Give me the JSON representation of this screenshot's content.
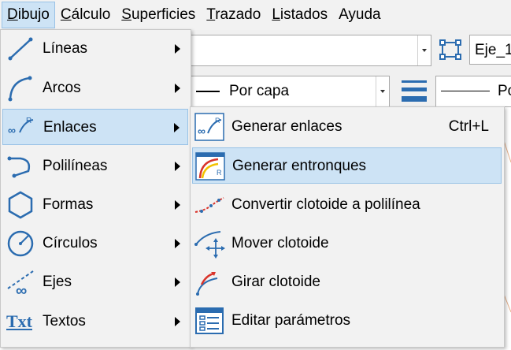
{
  "menubar": {
    "items": [
      {
        "label": "Dibujo",
        "accel": "D",
        "rest": "ibujo"
      },
      {
        "label": "Cálculo",
        "accel": "C",
        "rest": "álculo"
      },
      {
        "label": "Superficies",
        "accel": "S",
        "rest": "uperficies"
      },
      {
        "label": "Trazado",
        "accel": "T",
        "rest": "razado"
      },
      {
        "label": "Listados",
        "accel": "L",
        "rest": "istados"
      },
      {
        "label": "Ayuda",
        "accel": "",
        "rest": "Ayuda"
      }
    ]
  },
  "toolbar": {
    "axis_value": "Eje_1",
    "linetype_value": "Por capa",
    "lineweight_value": "Po"
  },
  "menu": {
    "items": [
      {
        "label": "Líneas",
        "icon": "lines-icon"
      },
      {
        "label": "Arcos",
        "icon": "arcs-icon"
      },
      {
        "label": "Enlaces",
        "icon": "links-icon"
      },
      {
        "label": "Polilíneas",
        "icon": "polylines-icon"
      },
      {
        "label": "Formas",
        "icon": "hexagon-icon"
      },
      {
        "label": "Círculos",
        "icon": "circle-icon"
      },
      {
        "label": "Ejes",
        "icon": "axis-icon"
      },
      {
        "label": "Textos",
        "icon": "text-icon",
        "icon_text": "Txt"
      }
    ]
  },
  "submenu": {
    "items": [
      {
        "label": "Generar enlaces",
        "shortcut": "Ctrl+L",
        "icon": "generate-links-icon"
      },
      {
        "label": "Generar entronques",
        "shortcut": "",
        "icon": "generate-junctions-icon"
      },
      {
        "label": "Convertir clotoide a polilínea",
        "shortcut": "",
        "icon": "convert-clothoid-icon"
      },
      {
        "label": "Mover clotoide",
        "shortcut": "",
        "icon": "move-clothoid-icon"
      },
      {
        "label": "Girar clotoide",
        "shortcut": "",
        "icon": "rotate-clothoid-icon"
      },
      {
        "label": "Editar parámetros",
        "shortcut": "",
        "icon": "edit-parameters-icon"
      }
    ]
  },
  "colors": {
    "highlight": "#cde3f5",
    "icon_blue": "#2b6cb0",
    "accent_red": "#d9342b",
    "accent_yellow": "#f2c200"
  }
}
